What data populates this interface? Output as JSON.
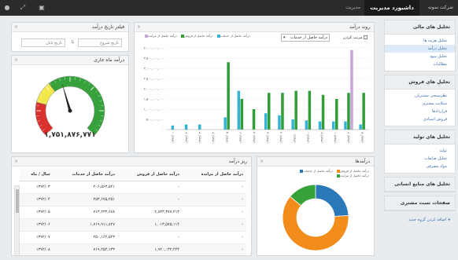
{
  "topbar": {
    "brand": "شرکت نمونه",
    "active_tab": "داشبورد مدیریت",
    "tab2": "مدیریت",
    "icons": [
      "user-icon",
      "expand-icon",
      "print-icon"
    ]
  },
  "sidebar": {
    "groups": [
      {
        "title": "تحلیل های مالی",
        "items": [
          "تحلیل هزینه ها",
          "تحلیل درآمد",
          "تحلیل سود",
          "مطالبات"
        ],
        "active": 1
      },
      {
        "title": "تحلیل های فروش",
        "items": [
          "نظرسنجی مشتریان",
          "شکایت مشتری",
          "قراردادها",
          "فروش اسنادی"
        ]
      },
      {
        "title": "تحلیل های تولید",
        "items": [
          "تولید",
          "تحلیل ضایعات",
          "مواد مصرفی"
        ]
      },
      {
        "title": "تحلیل های منابع انسانی",
        "items": []
      },
      {
        "title": "صفحات تست مشتری",
        "items": []
      }
    ],
    "add_group": "اضافه کردن گروه جدید"
  },
  "date_filter": {
    "title": "فیلتر تاریخ درآمد",
    "start_placeholder": "تاریخ شروع",
    "end_placeholder": "تاریخ پایان",
    "separator": "تا"
  },
  "gauge": {
    "title": "درآمد ماه جاری",
    "value_text": "۱,۷۵۱,۸۷۶,۷۷۱",
    "level": 0.44,
    "colors": {
      "red": "#d9322e",
      "yellow": "#f2e84b",
      "green": "#37a23c"
    }
  },
  "trend": {
    "title": "روند درآمد",
    "sort_label": "مرتب کردن",
    "select_value": "درآمد حاصل از خدمات",
    "legend": [
      {
        "label": "درآمد حاصل از خدمات",
        "color": "#35b3d4"
      },
      {
        "label": "درآمد حاصل از فروش",
        "color": "#2f9e37"
      },
      {
        "label": "درآمد حاصل از مزایده",
        "color": "#c7a6d8"
      }
    ]
  },
  "chart_data": {
    "type": "bar",
    "y_ticks": [
      "۴,۰۰۰,۰۰۰,۰۰۰",
      "۳,۵۰۰,۰۰۰,۰۰۰",
      "۳,۰۰۰,۰۰۰,۰۰۰",
      "۲,۵۰۰,۰۰۰,۰۰۰",
      "۲,۰۰۰,۰۰۰,۰۰۰",
      "۱,۵۰۰,۰۰۰,۰۰۰",
      "۱,۰۰۰,۰۰۰,۰۰۰",
      "۵۰۰,۰۰۰,۰۰۰",
      "۰"
    ],
    "ylim": [
      0,
      4000000000
    ],
    "categories": [
      "۱۳۹۲/۰۱",
      "۱۳۹۲/۰۲",
      "۱۳۹۲/۰۳",
      "۱۳۹۲/۰۴",
      "۱۳۹۲/۰۵",
      "۱۳۹۲/۰۶",
      "۱۳۹۲/۰۷",
      "۱۳۹۲/۰۸",
      "۱۳۹۲/۰۹",
      "۱۳۹۲/۱۰",
      "۱۳۹۲/۱۱",
      "۱۳۹۲/۱۲",
      "۱۳۹۳/۰۱",
      "۱۳۹۳/۰۲",
      "۱۳۹۳/۰۳"
    ],
    "series": [
      {
        "name": "درآمد حاصل از خدمات",
        "values": [
          200000000,
          250000000,
          250000000,
          0,
          600000000,
          1900000000,
          0,
          800000000,
          700000000,
          500000000,
          450000000,
          400000000,
          400000000,
          400000000,
          250000000
        ]
      },
      {
        "name": "درآمد حاصل از فروش",
        "values": [
          0,
          0,
          0,
          0,
          3300000000,
          1500000000,
          1000000000,
          1800000000,
          1800000000,
          1900000000,
          1900000000,
          1700000000,
          1500000000,
          1800000000,
          1800000000
        ]
      },
      {
        "name": "درآمد حاصل از مزایده",
        "values": [
          0,
          0,
          0,
          0,
          0,
          0,
          0,
          0,
          0,
          0,
          0,
          0,
          0,
          3900000000,
          0
        ]
      }
    ]
  },
  "table": {
    "title": "ریز درآمد",
    "headers": [
      "سال / ماه",
      "درآمد حاصل از خدمات",
      "درآمد حاصل از فروش",
      "درآمد حاصل از مزایده"
    ],
    "rows": [
      [
        "۱۳۹۲/۰۳",
        "۲۰۶,۵۶۳,۵۲۱",
        "-",
        "-"
      ],
      [
        "۱۳۹۲/۰۴",
        "۲۵۳,۶۷۵,۲۵۱",
        "-",
        "-"
      ],
      [
        "۱۳۹۲/۰۵",
        "۷۱۳,۲۳۳,۶۷۸",
        "۲,۸۳۳,۳۷۷,۲۱۳",
        "-"
      ],
      [
        "۱۳۹۲/۰۶",
        "۱,۷۱۹,۹۱۱,۸۲۷",
        "۱,۰۱۳,۵۷۵,۱۱۴",
        "-"
      ],
      [
        "۱۳۹۲/۰۷",
        "۲۵۰,۱۶۲,۵۲۳",
        "-",
        "-"
      ],
      [
        "۱۳۹۲/۰۸",
        "۷۱۹,۲۵۴,۱۳۳",
        "۱,۹۲۰,۰۳۲,۴۴۴",
        "-"
      ]
    ]
  },
  "donut": {
    "title": "درآمدها",
    "legend": [
      "درآمد حاصل از خدمات",
      "درآمد حاصل از فروش",
      "درآمد حاصل از مزایده"
    ],
    "slices": [
      {
        "name": "درآمد حاصل از خدمات",
        "value": 24,
        "color": "#2b78b8"
      },
      {
        "name": "درآمد حاصل از فروش",
        "value": 62,
        "color": "#f28c1a"
      },
      {
        "name": "درآمد حاصل از مزایده",
        "value": 14,
        "color": "#36a23a"
      }
    ]
  }
}
